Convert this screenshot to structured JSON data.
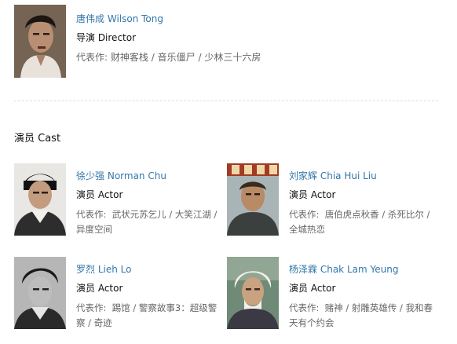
{
  "director": {
    "name_zh": "唐伟成",
    "name_en": "Wilson Tong",
    "role": "导演 Director",
    "works_label": "代表作:",
    "works": [
      "财神客栈",
      "音乐僵尸",
      "少林三十六房"
    ]
  },
  "cast_heading": "演员 Cast",
  "cast": [
    {
      "name_zh": "徐少强",
      "name_en": "Norman Chu",
      "role": "演员 Actor",
      "works_label": "代表作:",
      "works": [
        "武状元苏乞儿",
        "大笑江湖",
        "异度空间"
      ]
    },
    {
      "name_zh": "刘家辉",
      "name_en": "Chia Hui Liu",
      "role": "演员 Actor",
      "works_label": "代表作:",
      "works": [
        "唐伯虎点秋香",
        "杀死比尔",
        "全城热恋"
      ]
    },
    {
      "name_zh": "罗烈",
      "name_en": "Lieh Lo",
      "role": "演员 Actor",
      "works_label": "代表作:",
      "works": [
        "踢馆",
        "警察故事3：超级警察",
        "奇迹"
      ]
    },
    {
      "name_zh": "杨泽霖",
      "name_en": "Chak Lam Yeung",
      "role": "演员 Actor",
      "works_label": "代表作:",
      "works": [
        "赌神",
        "射雕英雄传",
        "我和春天有个约会"
      ]
    }
  ],
  "colors": {
    "link": "#3377aa",
    "muted": "#666666",
    "text": "#111111",
    "divider": "#dddddd"
  }
}
